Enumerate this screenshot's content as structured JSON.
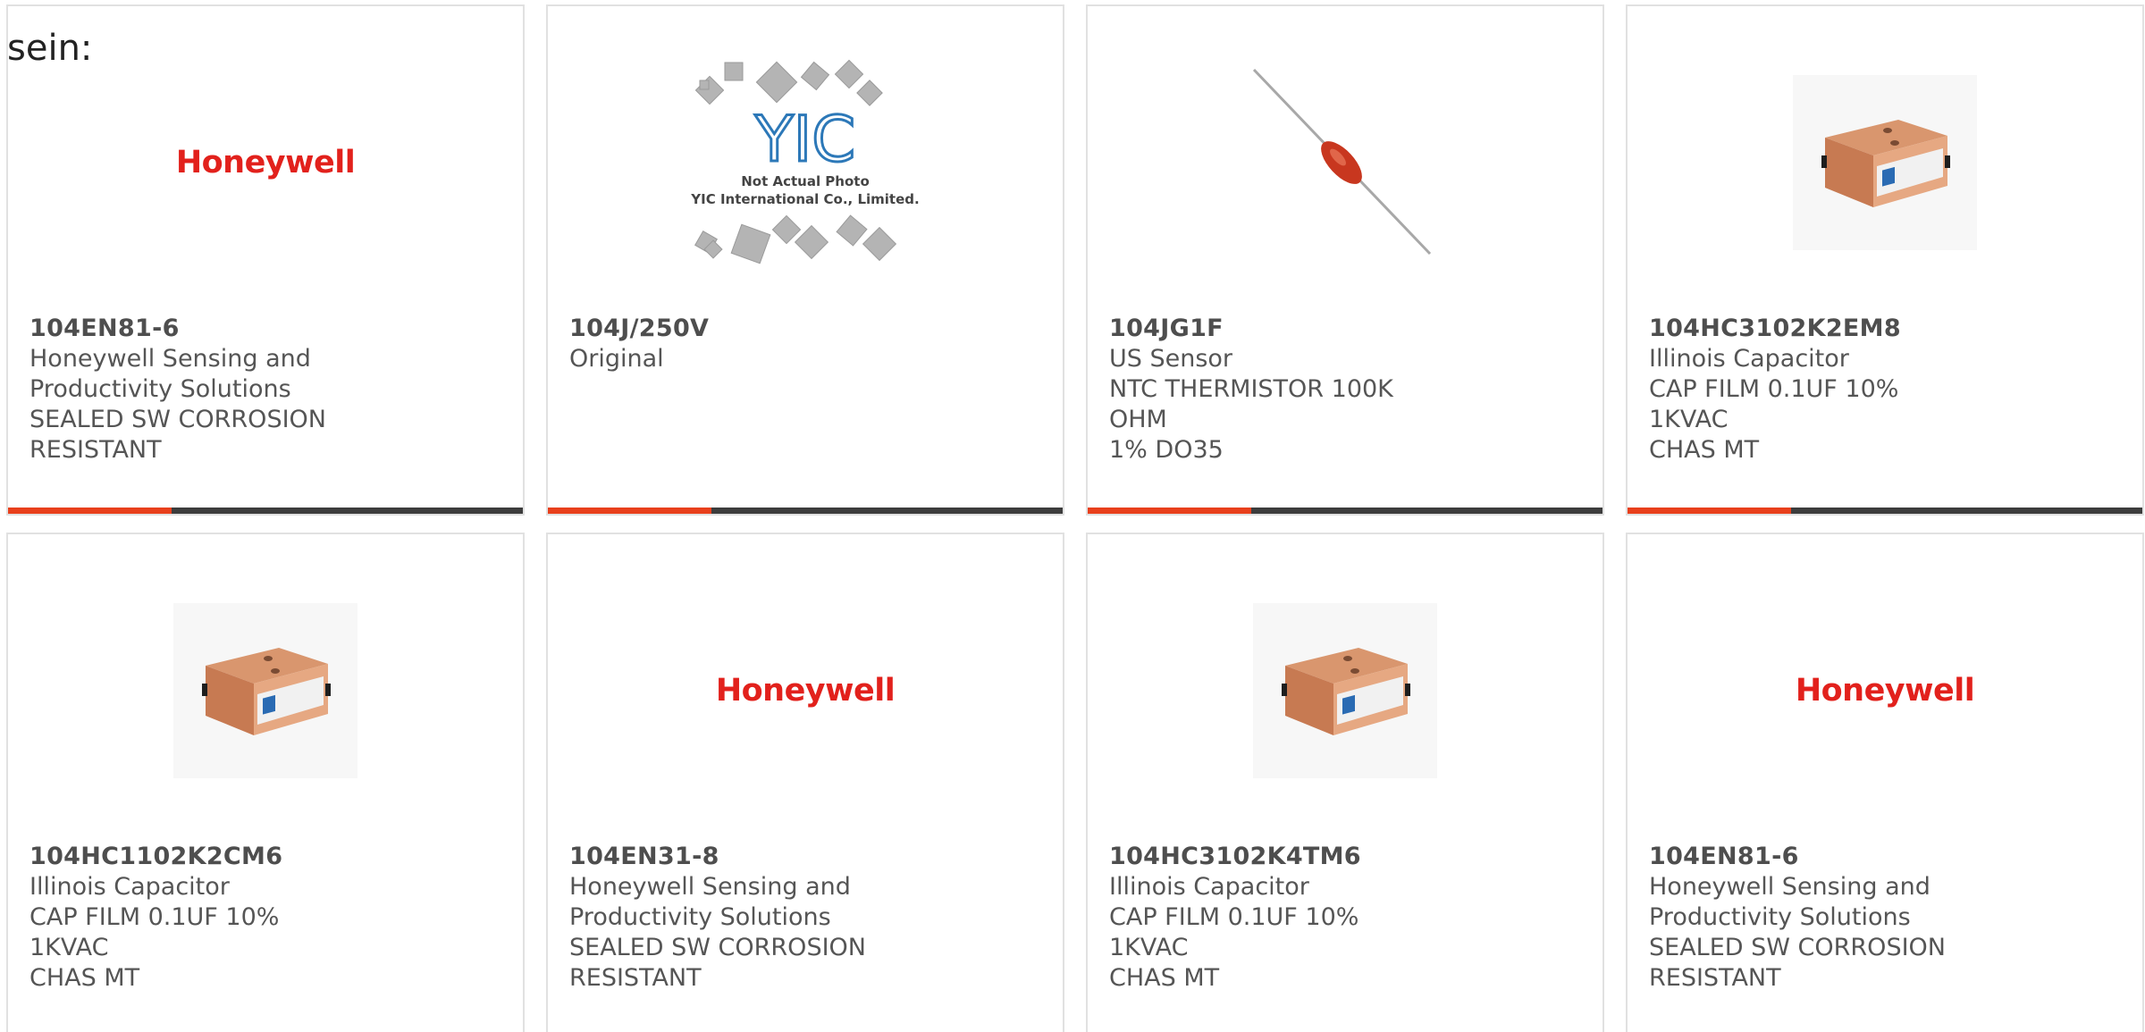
{
  "page_label": "sein:",
  "colors": {
    "accent": "#e8401c",
    "bar": "#3d3d3d",
    "border": "#e1e1e1",
    "logo_red": "#e2211c",
    "text": "#555555"
  },
  "products": [
    {
      "part": "104EN81-6",
      "lines": [
        "Honeywell Sensing and",
        "Productivity Solutions",
        "SEALED SW CORROSION",
        "RESISTANT"
      ],
      "image": "honeywell-logo",
      "logo_text": "Honeywell"
    },
    {
      "part": "104J/250V",
      "lines": [
        "Original"
      ],
      "image": "yic-placeholder",
      "logo_text": "YIC",
      "caption_1": "Not Actual Photo",
      "caption_2": "YIC International Co., Limited."
    },
    {
      "part": "104JG1F",
      "lines": [
        "US Sensor",
        "NTC THERMISTOR 100K OHM",
        "1% DO35"
      ],
      "image": "thermistor-photo"
    },
    {
      "part": "104HC3102K2EM8",
      "lines": [
        "Illinois Capacitor",
        "CAP FILM 0.1UF 10% 1KVAC",
        "CHAS MT"
      ],
      "image": "capacitor-photo"
    },
    {
      "part": "104HC1102K2CM6",
      "lines": [
        "Illinois Capacitor",
        "CAP FILM 0.1UF 10% 1KVAC",
        "CHAS MT"
      ],
      "image": "capacitor-photo"
    },
    {
      "part": "104EN31-8",
      "lines": [
        "Honeywell Sensing and",
        "Productivity Solutions",
        "SEALED SW CORROSION",
        "RESISTANT"
      ],
      "image": "honeywell-logo",
      "logo_text": "Honeywell"
    },
    {
      "part": "104HC3102K4TM6",
      "lines": [
        "Illinois Capacitor",
        "CAP FILM 0.1UF 10% 1KVAC",
        "CHAS MT"
      ],
      "image": "capacitor-photo"
    },
    {
      "part": "104EN81-6",
      "lines": [
        "Honeywell Sensing and",
        "Productivity Solutions",
        "SEALED SW CORROSION",
        "RESISTANT"
      ],
      "image": "honeywell-logo",
      "logo_text": "Honeywell"
    }
  ]
}
